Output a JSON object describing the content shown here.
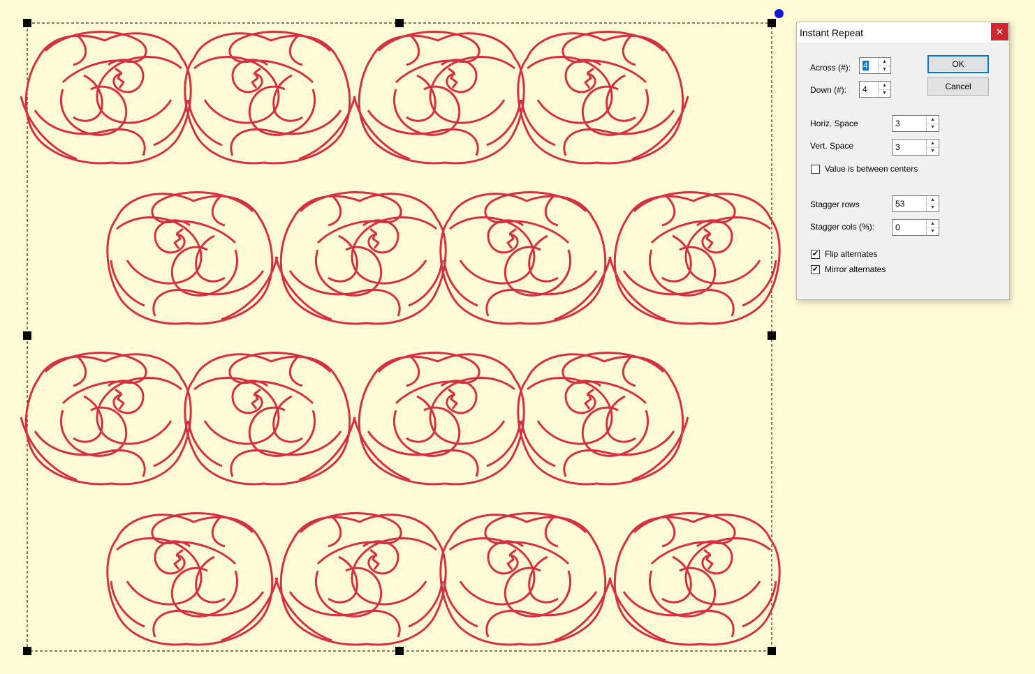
{
  "colors": {
    "canvas_background": "#fffbd6",
    "rose_stroke": "#d43040",
    "selection_handle": "#000000",
    "rotate_handle": "#1515e0"
  },
  "design": {
    "motif": "rose-outline",
    "rows": [
      {
        "count": 4,
        "offset": "left"
      },
      {
        "count": 4,
        "offset": "right"
      },
      {
        "count": 4,
        "offset": "left"
      },
      {
        "count": 4,
        "offset": "right"
      }
    ]
  },
  "dialog": {
    "title": "Instant Repeat",
    "close_glyph": "✕",
    "across_label": "Across (#):",
    "across_value": "4",
    "down_label": "Down (#):",
    "down_value": "4",
    "horiz_space_label": "Horiz. Space",
    "horiz_space_value": "3",
    "vert_space_label": "Vert. Space",
    "vert_space_value": "3",
    "between_centers_label": "Value is between centers",
    "between_centers_checked": false,
    "stagger_rows_label": "Stagger rows",
    "stagger_rows_value": "53",
    "stagger_cols_label": "Stagger cols (%):",
    "stagger_cols_value": "0",
    "flip_alternates_label": "Flip alternates",
    "flip_alternates_checked": true,
    "mirror_alternates_label": "Mirror alternates",
    "mirror_alternates_checked": true,
    "ok_label": "OK",
    "cancel_label": "Cancel",
    "spin_up_glyph": "▲",
    "spin_down_glyph": "▼",
    "check_glyph": "✔"
  }
}
